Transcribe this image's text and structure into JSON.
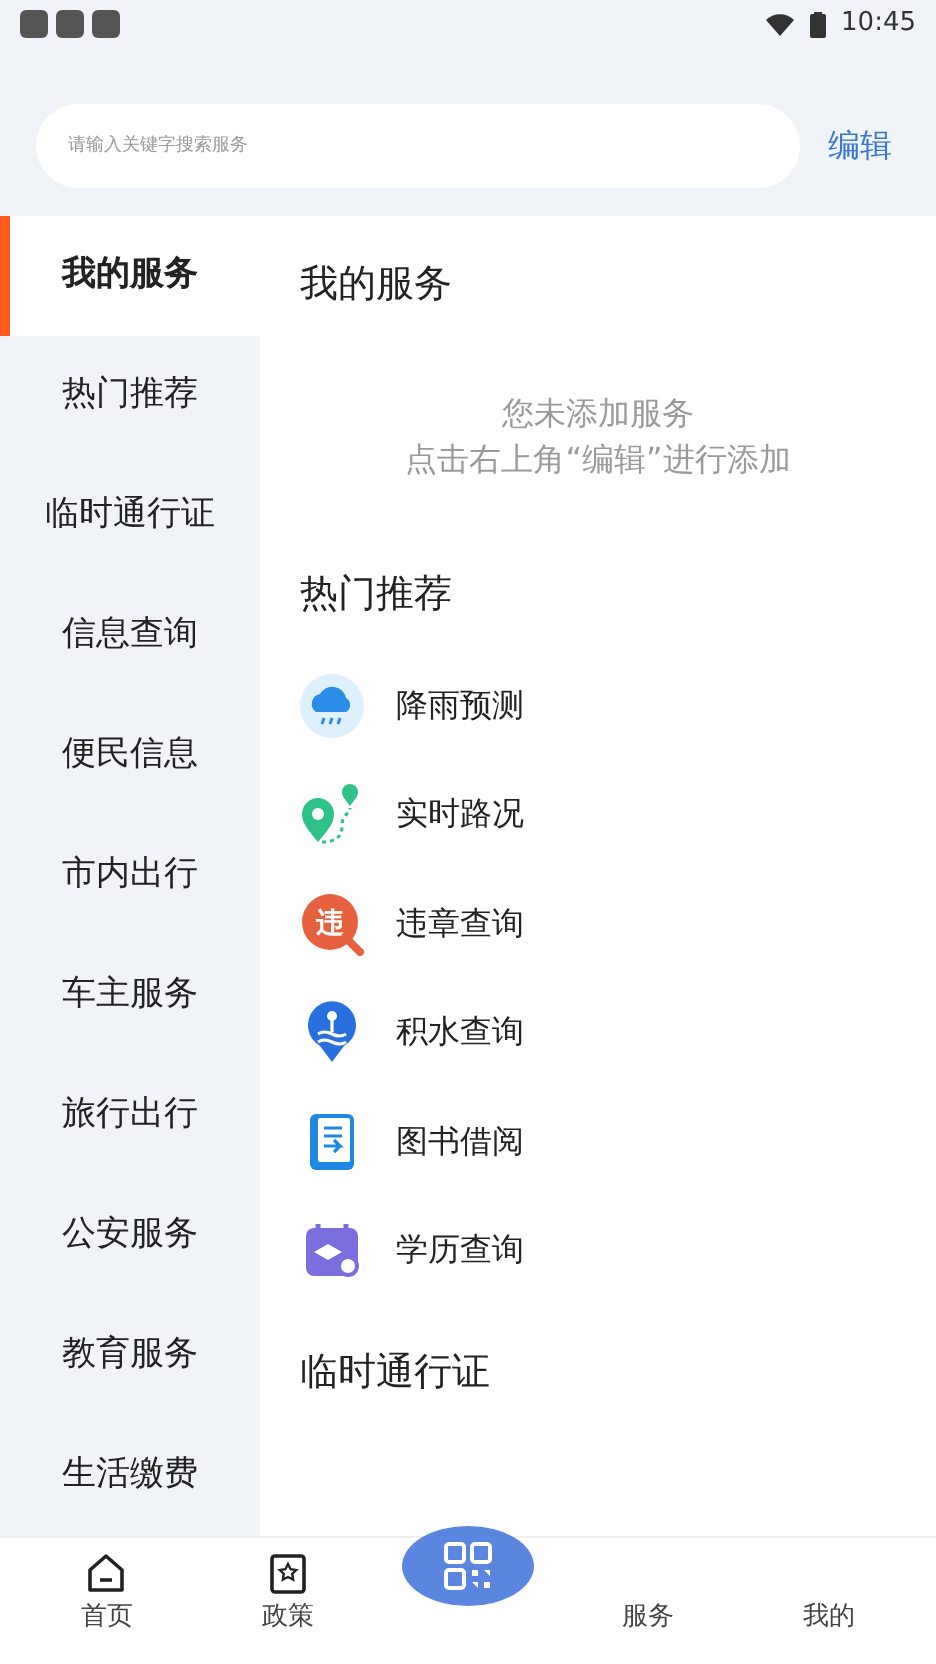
{
  "status_bar": {
    "time": "10:45"
  },
  "search": {
    "placeholder": "请输入关键字搜索服务"
  },
  "edit_button": "编辑",
  "sidebar": {
    "items": [
      {
        "label": "我的服务",
        "selected": true
      },
      {
        "label": "热门推荐",
        "selected": false
      },
      {
        "label": "临时通行证",
        "selected": false
      },
      {
        "label": "信息查询",
        "selected": false
      },
      {
        "label": "便民信息",
        "selected": false
      },
      {
        "label": "市内出行",
        "selected": false
      },
      {
        "label": "车主服务",
        "selected": false
      },
      {
        "label": "旅行出行",
        "selected": false
      },
      {
        "label": "公安服务",
        "selected": false
      },
      {
        "label": "教育服务",
        "selected": false
      },
      {
        "label": "生活缴费",
        "selected": false
      }
    ]
  },
  "sections": [
    {
      "title": "我的服务",
      "empty_lines": [
        "您未添加服务",
        "点击右上角“编辑”进行添加"
      ]
    },
    {
      "title": "热门推荐",
      "items": [
        {
          "label": "降雨预测",
          "kind": "rain"
        },
        {
          "label": "实时路况",
          "kind": "route"
        },
        {
          "label": "违章查询",
          "kind": "violation",
          "icon_text": "违"
        },
        {
          "label": "积水查询",
          "kind": "water"
        },
        {
          "label": "图书借阅",
          "kind": "book"
        },
        {
          "label": "学历查询",
          "kind": "degree"
        }
      ]
    },
    {
      "title": "临时通行证"
    }
  ],
  "bottom_nav": [
    {
      "label": "首页",
      "kind": "home"
    },
    {
      "label": "政策",
      "kind": "policy"
    },
    {
      "kind": "qr"
    },
    {
      "label": "服务"
    },
    {
      "label": "我的"
    }
  ]
}
